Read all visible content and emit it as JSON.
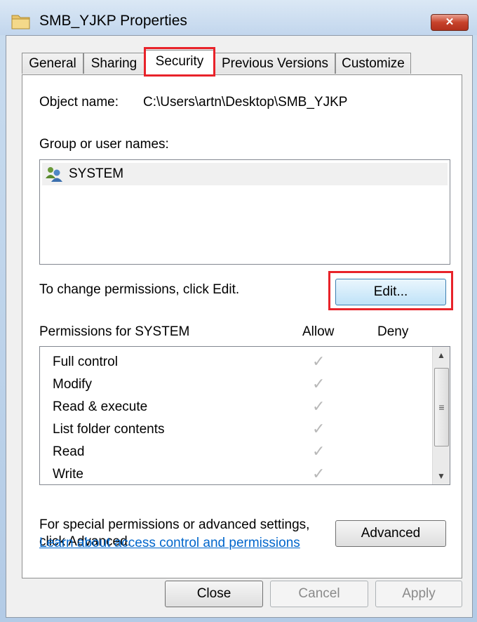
{
  "window": {
    "title": "SMB_YJKP Properties",
    "close_label": "✕"
  },
  "tabs": [
    {
      "label": "General"
    },
    {
      "label": "Sharing"
    },
    {
      "label": "Security",
      "active": true
    },
    {
      "label": "Previous Versions"
    },
    {
      "label": "Customize"
    }
  ],
  "security": {
    "object_name_label": "Object name:",
    "object_name_value": "C:\\Users\\artn\\Desktop\\SMB_YJKP",
    "group_label": "Group or user names:",
    "users": [
      {
        "name": "SYSTEM",
        "selected": true
      }
    ],
    "change_hint": "To change permissions, click Edit.",
    "edit_button": "Edit...",
    "permissions_for": "Permissions for SYSTEM",
    "allow_header": "Allow",
    "deny_header": "Deny",
    "permissions": [
      {
        "name": "Full control",
        "allow": "✓"
      },
      {
        "name": "Modify",
        "allow": "✓"
      },
      {
        "name": "Read & execute",
        "allow": "✓"
      },
      {
        "name": "List folder contents",
        "allow": "✓"
      },
      {
        "name": "Read",
        "allow": "✓"
      },
      {
        "name": "Write",
        "allow": "✓"
      }
    ],
    "special_line1": "For special permissions or advanced settings,",
    "special_line2": "click Advanced.",
    "advanced_button": "Advanced",
    "learn_link": "Learn about access control and permissions"
  },
  "footer": {
    "close": "Close",
    "cancel": "Cancel",
    "apply": "Apply"
  },
  "colors": {
    "highlight": "#e8232a",
    "link": "#0066cc"
  }
}
